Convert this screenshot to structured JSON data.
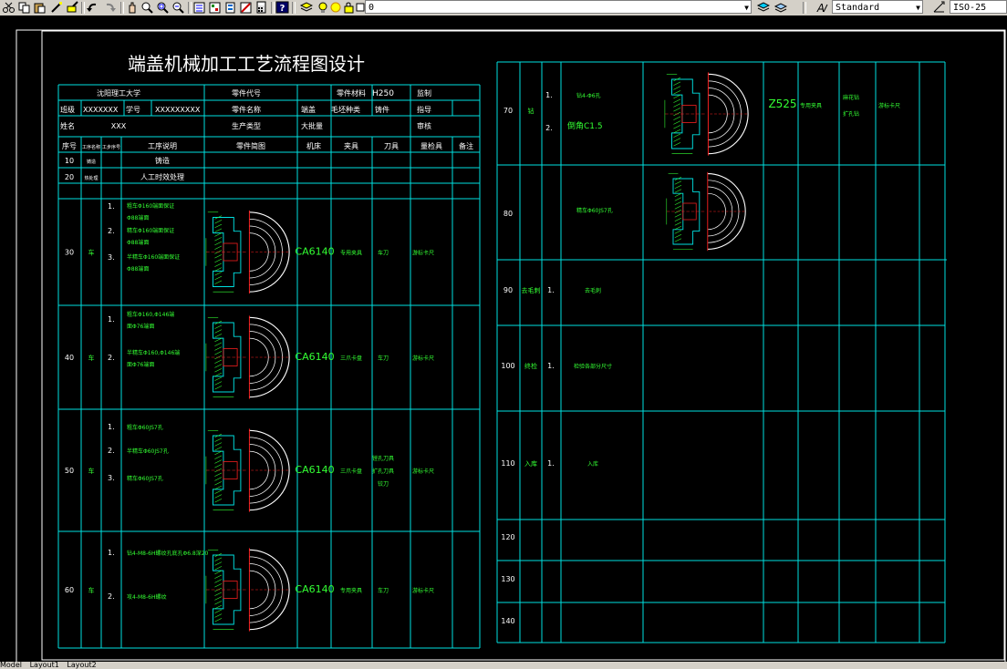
{
  "toolbar": {
    "layer_value": "0",
    "text_style_value": "Standard",
    "dim_style_value": "ISO-25",
    "buttons": [
      "cut-icon",
      "copy-icon",
      "paste-icon",
      "match-properties-icon",
      "brush-icon",
      "undo-icon",
      "redo-icon",
      "pan-icon",
      "zoom-realtime-icon",
      "zoom-window-icon",
      "zoom-previous-icon",
      "properties-icon",
      "design-center-icon",
      "tool-palette-icon",
      "markup-icon",
      "calculator-icon",
      "help-icon"
    ]
  },
  "drawing": {
    "title": "端盖机械加工工艺流程图设计",
    "left_header": {
      "r1": [
        "沈阳理工大学",
        "零件代号",
        "零件材料",
        "H250",
        "监制"
      ],
      "r2": [
        "班级",
        "XXXXXXX",
        "学号",
        "XXXXXXXXX",
        "零件名称",
        "端盖",
        "毛坯种类",
        "铸件",
        "指导"
      ],
      "r3": [
        "姓名",
        "XXX",
        "生产类型",
        "大批量",
        "审核"
      ],
      "cols": [
        "序号",
        "工序名称",
        "工步序号",
        "工序说明",
        "零件简图",
        "机床",
        "夹具",
        "刀具",
        "量检具",
        "备注"
      ]
    },
    "left_rows": [
      {
        "no": "10",
        "name": "铸造",
        "desc": "铸造"
      },
      {
        "no": "20",
        "name": "热处理",
        "desc": "人工时效处理"
      },
      {
        "no": "30",
        "name": "车",
        "steps": [
          "1.",
          "2.",
          "3."
        ],
        "notes": [
          "粗车Φ160端面保证",
          "Φ88端面",
          "精车Φ160端面保证",
          "Φ88端面",
          "半精车Φ160端面保证",
          "Φ88端面"
        ],
        "machine": "CA6140",
        "fixture": "专用夹具",
        "tool": "车刀",
        "gauge": "游标卡尺"
      },
      {
        "no": "40",
        "name": "车",
        "steps": [
          "1.",
          "2."
        ],
        "notes": [
          "粗车Φ160,Φ146端",
          "面Φ76端面",
          "半精车Φ160,Φ146端",
          "面Φ76端面"
        ],
        "machine": "CA6140",
        "fixture": "三爪卡盘",
        "tool": "车刀",
        "gauge": "游标卡尺"
      },
      {
        "no": "50",
        "name": "车",
        "steps": [
          "1.",
          "2.",
          "3."
        ],
        "notes": [
          "粗车Φ60JS7孔",
          "半精车Φ60JS7孔",
          "精车Φ60JS7孔"
        ],
        "machine": "CA6140",
        "fixture": "三爪卡盘",
        "tool": [
          "镗孔刀具",
          "扩孔刀具",
          "铰刀"
        ],
        "gauge": "游标卡尺"
      },
      {
        "no": "60",
        "name": "车",
        "steps": [
          "1.",
          "2."
        ],
        "notes": [
          "钻4-M8-6H螺纹孔底孔Φ6.8深20",
          "攻4-M8-6H螺纹"
        ],
        "machine": "CA6140",
        "fixture": "专用夹具",
        "tool": "车刀",
        "gauge": "游标卡尺"
      }
    ],
    "right_rows": [
      {
        "no": "70",
        "name": "钻",
        "steps": [
          "1.",
          "2."
        ],
        "notes": [
          "钻4-Φ6孔",
          "倒角C1.5"
        ],
        "machine": "Z525",
        "fixture": "专用夹具",
        "tool": [
          "麻花钻",
          "扩孔钻"
        ],
        "gauge": "游标卡尺"
      },
      {
        "no": "80",
        "notes": [
          "精车Φ60JS7孔"
        ]
      },
      {
        "no": "90",
        "name": "去毛刺",
        "steps": [
          "1."
        ],
        "notes": [
          "去毛刺"
        ]
      },
      {
        "no": "100",
        "name": "终检",
        "steps": [
          "1."
        ],
        "notes": [
          "检验各部分尺寸"
        ]
      },
      {
        "no": "110",
        "name": "入库",
        "steps": [
          "1."
        ],
        "notes": [
          "入库"
        ]
      },
      {
        "no": "120"
      },
      {
        "no": "130"
      },
      {
        "no": "140"
      }
    ]
  },
  "status": {
    "tabs": [
      "Model",
      "Layout1",
      "Layout2"
    ]
  }
}
